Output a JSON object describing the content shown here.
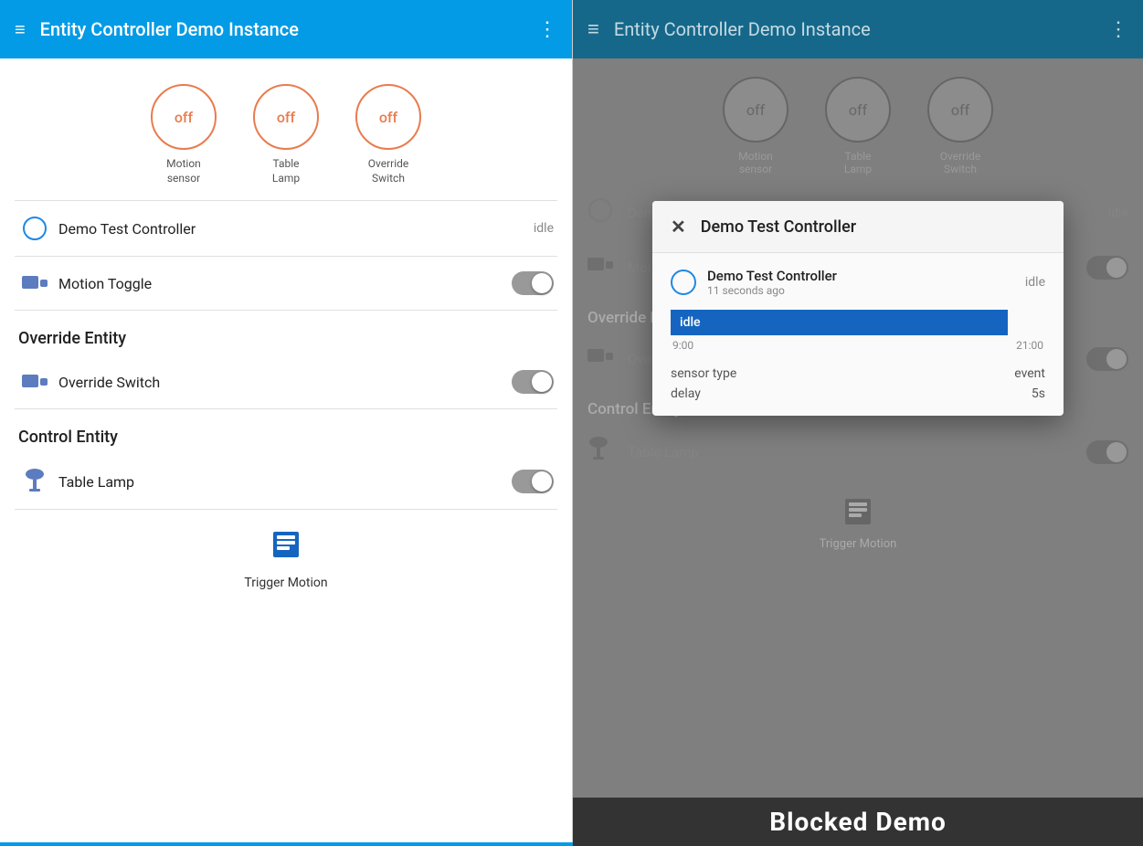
{
  "left": {
    "appBar": {
      "title": "Entity Controller Demo Instance",
      "menuIcon": "≡",
      "moreIcon": "⋮"
    },
    "statusCircles": [
      {
        "state": "off",
        "label": "Motion\nsensor"
      },
      {
        "state": "off",
        "label": "Table\nLamp"
      },
      {
        "state": "off",
        "label": "Override\nSwitch"
      }
    ],
    "controller": {
      "icon": "○",
      "name": "Demo Test Controller",
      "status": "idle"
    },
    "motionToggle": {
      "label": "Motion Toggle"
    },
    "overrideSection": {
      "heading": "Override Entity",
      "items": [
        {
          "label": "Override Switch"
        }
      ]
    },
    "controlSection": {
      "heading": "Control Entity",
      "items": [
        {
          "label": "Table Lamp"
        }
      ]
    },
    "triggerMotion": {
      "label": "Trigger Motion"
    }
  },
  "right": {
    "appBar": {
      "title": "Entity Controller Demo Instance",
      "menuIcon": "≡",
      "moreIcon": "⋮"
    },
    "statusCircles": [
      {
        "state": "off",
        "label": "Motion\nsensor"
      },
      {
        "state": "off",
        "label": "Table\nLamp"
      },
      {
        "state": "off",
        "label": "Override\nSwitch"
      }
    ],
    "controller": {
      "name": "Demo Test Controller",
      "status": "idle"
    },
    "controlSection": {
      "heading": "Control Entity",
      "items": [
        {
          "label": "Table Lamp"
        }
      ]
    },
    "triggerMotion": {
      "label": "Trigger Motion"
    }
  },
  "modal": {
    "title": "Demo Test Controller",
    "closeIcon": "✕",
    "entity": {
      "name": "Demo Test Controller",
      "timeAgo": "11 seconds ago",
      "status": "idle"
    },
    "idleBar": {
      "label": "idle",
      "startTime": "9:00",
      "endTime": "21:00"
    },
    "metadata": [
      {
        "key": "sensor type",
        "value": "event"
      },
      {
        "key": "delay",
        "value": "5s"
      }
    ]
  },
  "blockedDemo": {
    "text": "Blocked Demo"
  }
}
